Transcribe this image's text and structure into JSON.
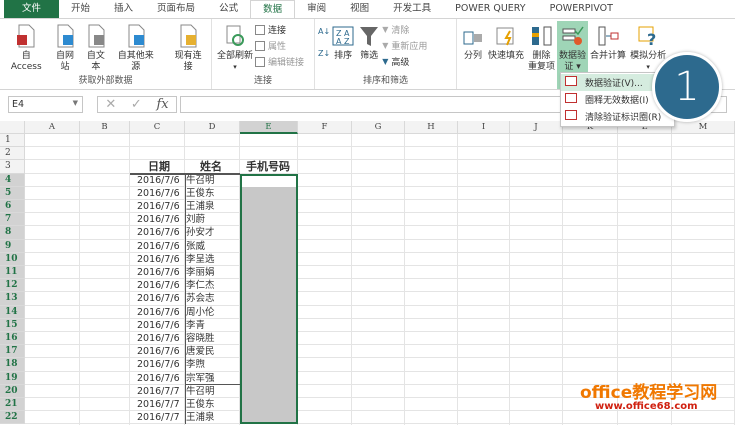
{
  "tabs": [
    "文件",
    "开始",
    "插入",
    "页面布局",
    "公式",
    "数据",
    "审阅",
    "视图",
    "开发工具",
    "POWER QUERY",
    "POWERPIVOT"
  ],
  "ribbon": {
    "external": {
      "label": "获取外部数据",
      "buttons": [
        "自 Access",
        "自网站",
        "自文本",
        "自其他来源",
        "现有连接"
      ]
    },
    "connections": {
      "label": "连接",
      "refresh": "全部刷新",
      "items": [
        "连接",
        "属性",
        "编辑链接"
      ]
    },
    "sortfilter": {
      "label": "排序和筛选",
      "sort": "排序",
      "filter": "筛选",
      "items": [
        "清除",
        "重新应用",
        "高级"
      ]
    },
    "tools": {
      "split": "分列",
      "flash": "快速填充",
      "dedupe_1": "删除",
      "dedupe_2": "重复项",
      "validate_1": "数据验",
      "validate_2": "证 ▾",
      "consolidate": "合并计算",
      "whatif": "模拟分析"
    }
  },
  "menu": [
    "数据验证(V)...",
    "圈释无效数据(I)",
    "清除验证标识圈(R)"
  ],
  "badge": "1",
  "namebox": "E4",
  "columns": [
    "A",
    "B",
    "C",
    "D",
    "E",
    "F",
    "G",
    "H",
    "I",
    "J",
    "K",
    "L",
    "M"
  ],
  "headers": {
    "date": "日期",
    "name": "姓名",
    "phone": "手机号码"
  },
  "rows": [
    [
      "2016/7/6",
      "牛召明"
    ],
    [
      "2016/7/6",
      "王俊东"
    ],
    [
      "2016/7/6",
      "王浦泉"
    ],
    [
      "2016/7/6",
      "刘蔚"
    ],
    [
      "2016/7/6",
      "孙安才"
    ],
    [
      "2016/7/6",
      "张威"
    ],
    [
      "2016/7/6",
      "李呈选"
    ],
    [
      "2016/7/6",
      "李丽娟"
    ],
    [
      "2016/7/6",
      "李仁杰"
    ],
    [
      "2016/7/6",
      "苏会志"
    ],
    [
      "2016/7/6",
      "周小伦"
    ],
    [
      "2016/7/6",
      "李青"
    ],
    [
      "2016/7/6",
      "容晓胜"
    ],
    [
      "2016/7/6",
      "唐爱民"
    ],
    [
      "2016/7/6",
      "李煦"
    ],
    [
      "2016/7/6",
      "宗军强"
    ],
    [
      "2016/7/7",
      "牛召明"
    ],
    [
      "2016/7/7",
      "王俊东"
    ],
    [
      "2016/7/7",
      "王浦泉"
    ]
  ],
  "watermark": {
    "title": "office教程学习网",
    "url": "www.office68.com"
  }
}
